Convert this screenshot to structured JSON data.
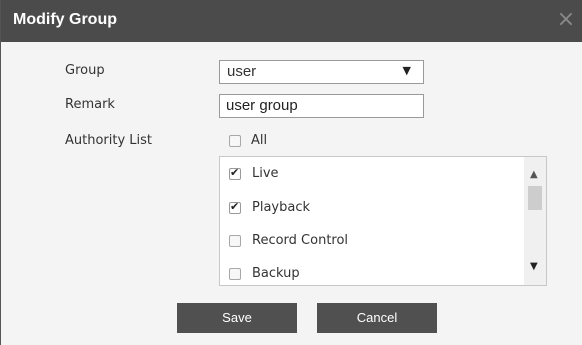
{
  "dialog": {
    "title": "Modify Group",
    "close_glyph": "×"
  },
  "form": {
    "group_label": "Group",
    "group_value": "user",
    "remark_label": "Remark",
    "remark_value": "user group",
    "authority_label": "Authority List",
    "all_label": "All",
    "all_checked": false
  },
  "authority_items": [
    {
      "label": "Live",
      "checked": true
    },
    {
      "label": "Playback",
      "checked": true
    },
    {
      "label": "Record Control",
      "checked": false
    },
    {
      "label": "Backup",
      "checked": false
    }
  ],
  "buttons": {
    "save": "Save",
    "cancel": "Cancel"
  },
  "icons": {
    "close": "close-icon",
    "dropdown": "chevron-down-icon",
    "scroll_up": "scroll-up-icon",
    "scroll_down": "scroll-down-icon"
  }
}
